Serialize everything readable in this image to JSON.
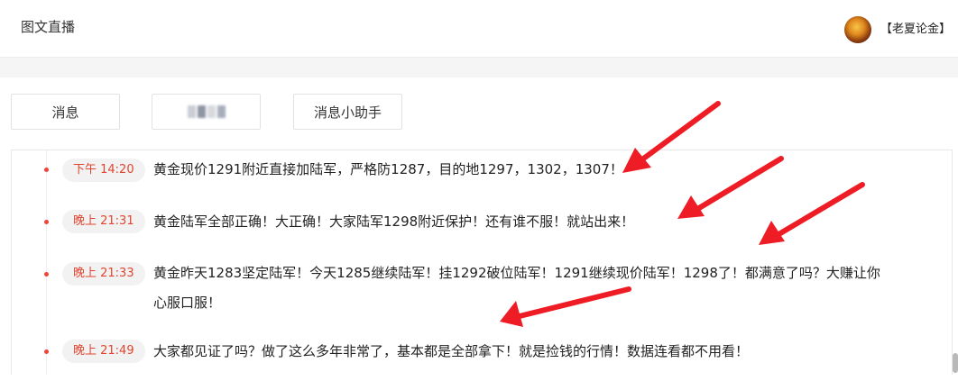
{
  "header": {
    "title": "图文直播",
    "user_name": "【老夏论金】"
  },
  "tabs": [
    {
      "label": "消息"
    },
    {
      "label": ""
    },
    {
      "label": "消息小助手"
    }
  ],
  "feed": {
    "items": [
      {
        "time": "下午 14:20",
        "text": "黄金现价1291附近直接加陆军，严格防1287，目的地1297，1302，1307！"
      },
      {
        "time": "晚上 21:31",
        "text": "黄金陆军全部正确！大正确！大家陆军1298附近保护！还有谁不服！就站出来！"
      },
      {
        "time": "晚上 21:33",
        "text_line1": "黄金昨天1283坚定陆军！今天1285继续陆军！挂1292破位陆军！1291继续现价陆军！1298了！都满意了吗？大赚让你",
        "text_line2": "心服口服！"
      },
      {
        "time": "晚上 21:49",
        "text": "大家都见证了吗？做了这么多年非常了，基本都是全部拿下！就是捡钱的行情！数据连看都不用看！"
      }
    ]
  },
  "colors": {
    "accent": "#f0433a",
    "time_text": "#e1452f",
    "annotation_arrow": "#ee1c25"
  }
}
